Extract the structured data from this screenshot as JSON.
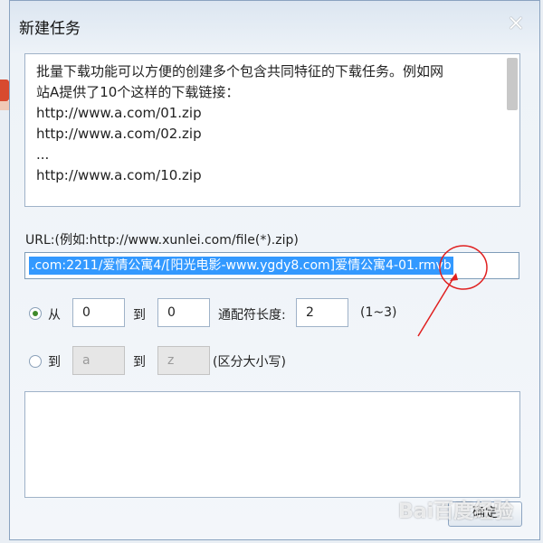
{
  "dialog": {
    "title": "新建任务",
    "close_glyph": "×"
  },
  "description": {
    "lines": [
      "批量下载功能可以方便的创建多个包含共同特征的下载任务。例如网",
      "站A提供了10个这样的下载链接：",
      "http://www.a.com/01.zip",
      "http://www.a.com/02.zip",
      "...",
      "http://www.a.com/10.zip"
    ]
  },
  "url": {
    "label": "URL:(例如:http://www.xunlei.com/file(*).zip)",
    "value": ".com:2211/爱情公寓4/[阳光电影-www.ygdy8.com]爱情公寓4-01.rmvb"
  },
  "range_numeric": {
    "from_label": "从",
    "from_value": "0",
    "to_label": "到",
    "to_value": "0",
    "wildcard_label": "通配符长度:",
    "wildcard_value": "2",
    "hint": "(1~3)",
    "selected": true
  },
  "range_alpha": {
    "from_label": "到",
    "from_value": "a",
    "to_label": "到",
    "to_value": "z",
    "hint": "(区分大小写)",
    "selected": false
  },
  "buttons": {
    "ok": "确定"
  },
  "watermark": "Bai百度经验",
  "colors": {
    "selection": "#3399ff",
    "annotation": "#e02020",
    "radio_dot": "#3f8a2a"
  }
}
